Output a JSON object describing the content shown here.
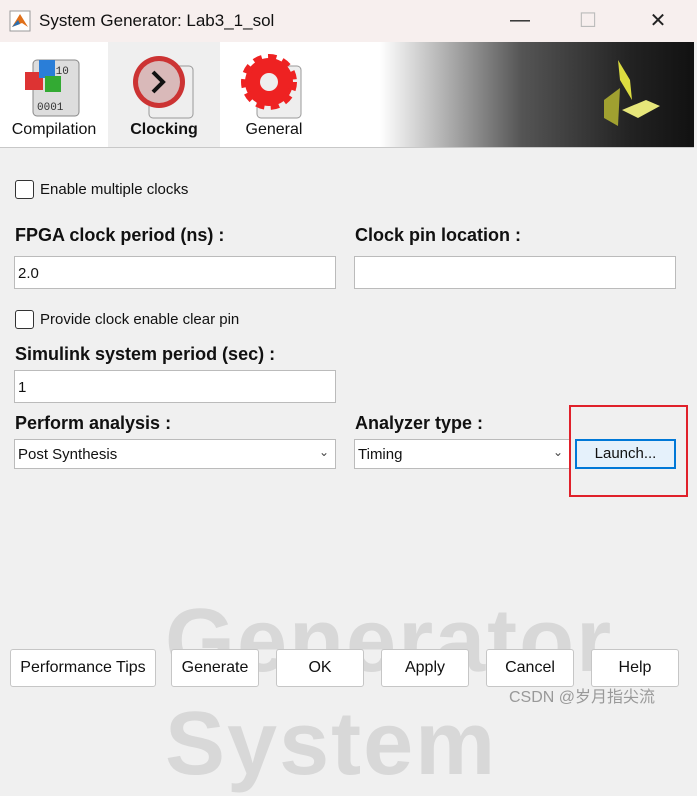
{
  "window": {
    "title": "System Generator: Lab3_1_sol",
    "minimize": "—",
    "maximize": "☐",
    "close": "✕"
  },
  "tabs": [
    {
      "label": "Compilation",
      "icon": "compilation-icon"
    },
    {
      "label": "Clocking",
      "icon": "clock-icon",
      "active": true
    },
    {
      "label": "General",
      "icon": "gear-icon"
    }
  ],
  "clocking": {
    "enable_multiple_clocks": {
      "label": "Enable multiple clocks",
      "checked": false
    },
    "fpga_clock_period": {
      "label": "FPGA clock period (ns) :",
      "value": "2.0"
    },
    "clock_pin_location": {
      "label": "Clock pin location :",
      "value": ""
    },
    "clock_enable_clear": {
      "label": "Provide clock enable clear pin",
      "checked": false
    },
    "simulink_period": {
      "label": "Simulink system period (sec) :",
      "value": "1"
    },
    "perform_analysis": {
      "label": "Perform analysis :",
      "value": "Post Synthesis"
    },
    "analyzer_type": {
      "label": "Analyzer type :",
      "value": "Timing"
    },
    "launch_label": "Launch..."
  },
  "buttons": {
    "performance_tips": "Performance Tips",
    "generate": "Generate",
    "ok": "OK",
    "apply": "Apply",
    "cancel": "Cancel",
    "help": "Help"
  },
  "background_watermark": "Generator System",
  "csdn_watermark": "CSDN @岁月指尖流",
  "colors": {
    "highlight": "#e0202a",
    "focus": "#0078d7"
  }
}
